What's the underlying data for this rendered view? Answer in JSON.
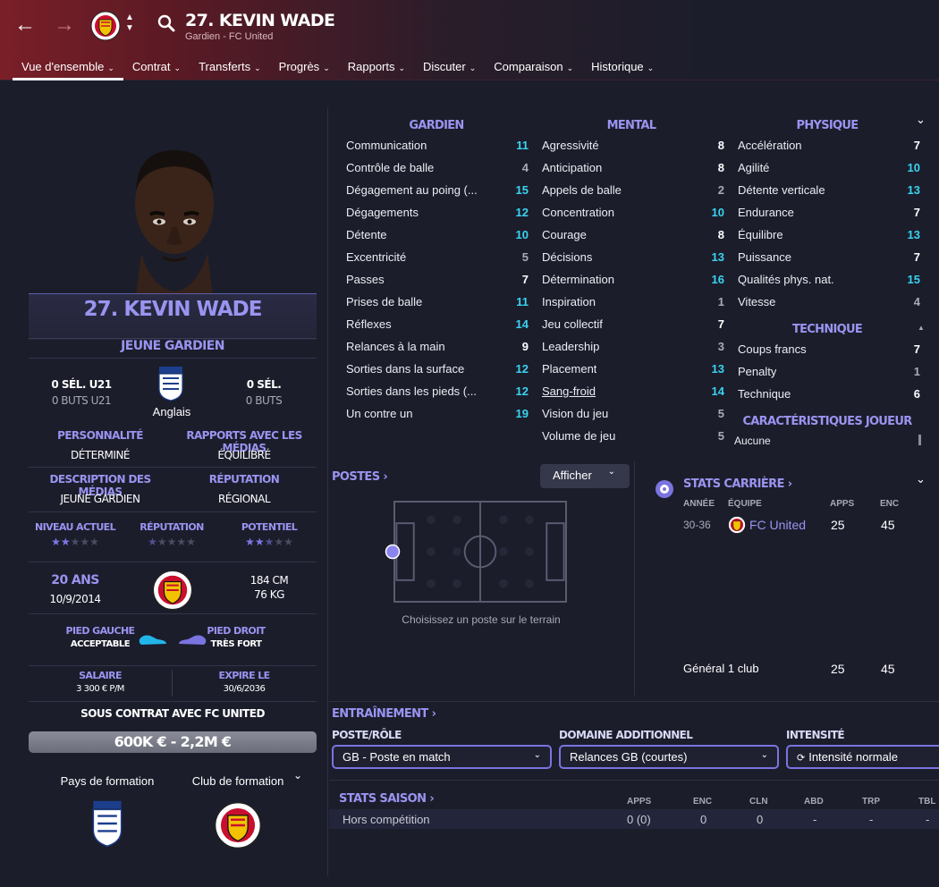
{
  "header": {
    "title": "27. KEVIN WADE",
    "subtitle": "Gardien - FC United",
    "tabs": [
      {
        "label": "Vue d'ensemble",
        "active": true
      },
      {
        "label": "Contrat"
      },
      {
        "label": "Transferts"
      },
      {
        "label": "Progrès"
      },
      {
        "label": "Rapports"
      },
      {
        "label": "Discuter"
      },
      {
        "label": "Comparaison"
      },
      {
        "label": "Historique"
      }
    ]
  },
  "profile": {
    "name": "27. KEVIN WADE",
    "role": "JEUNE GARDIEN",
    "u21_caps": "0 SÉL. U21",
    "u21_goals": "0 BUTS U21",
    "caps": "0 SÉL.",
    "goals": "0 BUTS",
    "nationality": "Anglais",
    "personality_label": "PERSONNALITÉ",
    "personality": "DÉTERMINÉ",
    "media_relations_label": "RAPPORTS AVEC LES MÉDIAS",
    "media_relations": "ÉQUILIBRÉ",
    "media_desc_label": "DESCRIPTION DES MÉDIAS",
    "media_desc": "JEUNE GARDIEN",
    "reputation_label": "RÉPUTATION",
    "reputation": "RÉGIONAL",
    "current_level_label": "NIVEAU ACTUEL",
    "current_level_stars": 2,
    "reputation_stars_label": "RÉPUTATION",
    "reputation_stars": 0.5,
    "potential_label": "POTENTIEL",
    "potential_stars": 2.5,
    "age": "20 ANS",
    "dob": "10/9/2014",
    "height": "184 CM",
    "weight": "76 KG",
    "left_foot_label": "PIED GAUCHE",
    "left_foot": "ACCEPTABLE",
    "right_foot_label": "PIED DROIT",
    "right_foot": "TRÈS FORT",
    "salary_label": "SALAIRE",
    "salary": "3 300 € P/M",
    "expires_label": "EXPIRE LE",
    "expires": "30/6/2036",
    "contract": "SOUS CONTRAT AVEC FC UNITED",
    "value": "600K € - 2,2M €",
    "training_country_label": "Pays de formation",
    "training_club_label": "Club de formation"
  },
  "attributes": {
    "gardien_title": "GARDIEN",
    "mental_title": "MENTAL",
    "physique_title": "PHYSIQUE",
    "technique_title": "TECHNIQUE",
    "traits_title": "CARACTÉRISTIQUES JOUEUR",
    "traits_first": "Aucune",
    "gardien": [
      {
        "name": "Communication",
        "value": 11
      },
      {
        "name": "Contrôle de balle",
        "value": 4
      },
      {
        "name": "Dégagement au poing (...",
        "value": 15
      },
      {
        "name": "Dégagements",
        "value": 12
      },
      {
        "name": "Détente",
        "value": 10
      },
      {
        "name": "Excentricité",
        "value": 5
      },
      {
        "name": "Passes",
        "value": 7
      },
      {
        "name": "Prises de balle",
        "value": 11
      },
      {
        "name": "Réflexes",
        "value": 14
      },
      {
        "name": "Relances à la main",
        "value": 9
      },
      {
        "name": "Sorties dans la surface",
        "value": 12
      },
      {
        "name": "Sorties dans les pieds (...",
        "value": 12
      },
      {
        "name": "Un contre un",
        "value": 19
      }
    ],
    "mental": [
      {
        "name": "Agressivité",
        "value": 8
      },
      {
        "name": "Anticipation",
        "value": 8
      },
      {
        "name": "Appels de balle",
        "value": 2
      },
      {
        "name": "Concentration",
        "value": 10
      },
      {
        "name": "Courage",
        "value": 8
      },
      {
        "name": "Décisions",
        "value": 13
      },
      {
        "name": "Détermination",
        "value": 16
      },
      {
        "name": "Inspiration",
        "value": 1
      },
      {
        "name": "Jeu collectif",
        "value": 7
      },
      {
        "name": "Leadership",
        "value": 3
      },
      {
        "name": "Placement",
        "value": 13
      },
      {
        "name": "Sang-froid",
        "value": 14
      },
      {
        "name": "Vision du jeu",
        "value": 5
      },
      {
        "name": "Volume de jeu",
        "value": 5
      }
    ],
    "physique": [
      {
        "name": "Accélération",
        "value": 7
      },
      {
        "name": "Agilité",
        "value": 10
      },
      {
        "name": "Détente verticale",
        "value": 13
      },
      {
        "name": "Endurance",
        "value": 7
      },
      {
        "name": "Équilibre",
        "value": 13
      },
      {
        "name": "Puissance",
        "value": 7
      },
      {
        "name": "Qualités phys. nat.",
        "value": 15
      },
      {
        "name": "Vitesse",
        "value": 4
      }
    ],
    "technique": [
      {
        "name": "Coups francs",
        "value": 7
      },
      {
        "name": "Penalty",
        "value": 1
      },
      {
        "name": "Technique",
        "value": 6
      }
    ]
  },
  "positions": {
    "title": "POSTES",
    "show_button": "Afficher",
    "hint": "Choisissez un poste sur le terrain"
  },
  "career": {
    "title": "STATS CARRIÈRE",
    "headers": {
      "year": "ANNÉE",
      "team": "ÉQUIPE",
      "apps": "APPS",
      "goals": "ENC"
    },
    "rows": [
      {
        "year": "30-36",
        "team": "FC United",
        "apps": "25",
        "goals": "45"
      }
    ],
    "total_label": "Général 1 club",
    "total_apps": "25",
    "total_goals": "45"
  },
  "training": {
    "title": "ENTRAÎNEMENT",
    "role_label": "POSTE/RÔLE",
    "role_value": "GB - Poste en match",
    "extra_label": "DOMAINE ADDITIONNEL",
    "extra_value": "Relances GB (courtes)",
    "intensity_label": "INTENSITÉ",
    "intensity_value": "Intensité normale"
  },
  "season": {
    "title": "STATS SAISON",
    "headers": [
      "APPS",
      "ENC",
      "CLN",
      "ABD",
      "TRP",
      "TBL"
    ],
    "row_label": "Hors compétition",
    "row_values": [
      "0 (0)",
      "0",
      "0",
      "-",
      "-",
      "-"
    ]
  },
  "colors": {
    "accent": "#9a94f0",
    "high_value": "#3ad3f0",
    "background": "#1b1d2b"
  }
}
